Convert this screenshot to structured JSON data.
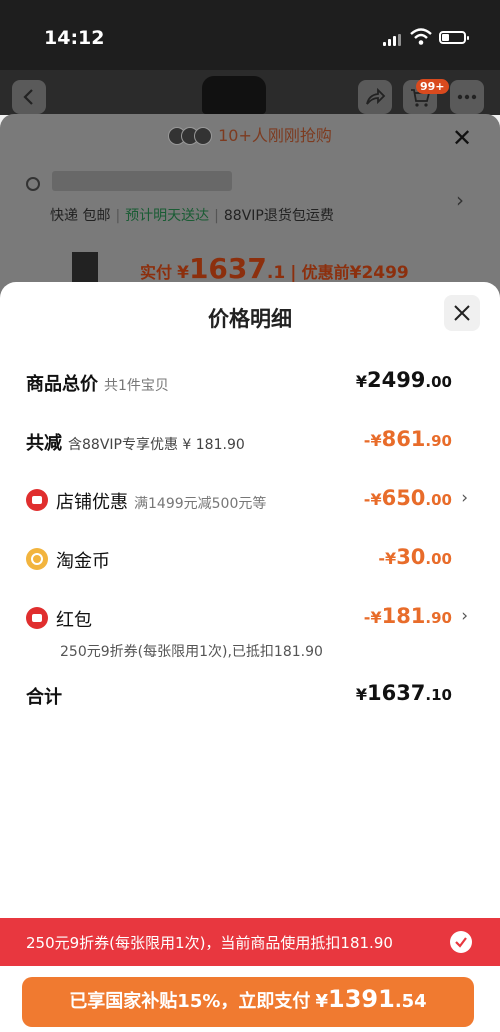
{
  "status_bar": {
    "time": "14:12"
  },
  "background": {
    "cart_badge": "99+",
    "grab_text": "10+人刚刚抢购",
    "shipping": {
      "express": "快递 包邮",
      "eta": "预计明天送达",
      "vip": "88VIP退货包运费"
    },
    "pay": {
      "label": "实付",
      "currency": "¥",
      "integer": "1637",
      "decimal": ".1",
      "before_label": "优惠前",
      "before_value": "¥2499"
    }
  },
  "panel": {
    "title": "价格明细",
    "rows": [
      {
        "label": "商品总价",
        "sub": "共1件宝贝",
        "currency": "¥",
        "integer": "2499",
        "decimal": ".00"
      },
      {
        "label": "共减",
        "sub": "含88VIP专享优惠 ¥ 181.90",
        "currency": "-¥",
        "integer": "861",
        "decimal": ".90"
      },
      {
        "label": "店铺优惠",
        "sub": "满1499元减500元等",
        "currency": "-¥",
        "integer": "650",
        "decimal": ".00",
        "icon": "store-coupon-icon"
      },
      {
        "label": "淘金币",
        "sub": "",
        "currency": "-¥",
        "integer": "30",
        "decimal": ".00",
        "icon": "taojinbi-coin-icon"
      },
      {
        "label": "红包",
        "sub": "",
        "currency": "-¥",
        "integer": "181",
        "decimal": ".90",
        "icon": "red-packet-icon"
      },
      {
        "label": "合计",
        "sub": "",
        "currency": "¥",
        "integer": "1637",
        "decimal": ".10"
      }
    ],
    "redpacket_note": "250元9折券(每张限用1次),已抵扣181.90"
  },
  "coupon_bar": {
    "text": "250元9折券(每张限用1次)，当前商品使用抵扣181.90"
  },
  "pay_button": {
    "text": "已享国家补贴15%，立即支付",
    "currency": "¥",
    "integer": "1391",
    "decimal": ".54"
  },
  "colors": {
    "accent_orange": "#f07a30",
    "discount_orange": "#e86c2a",
    "coupon_red": "#e8373f"
  }
}
